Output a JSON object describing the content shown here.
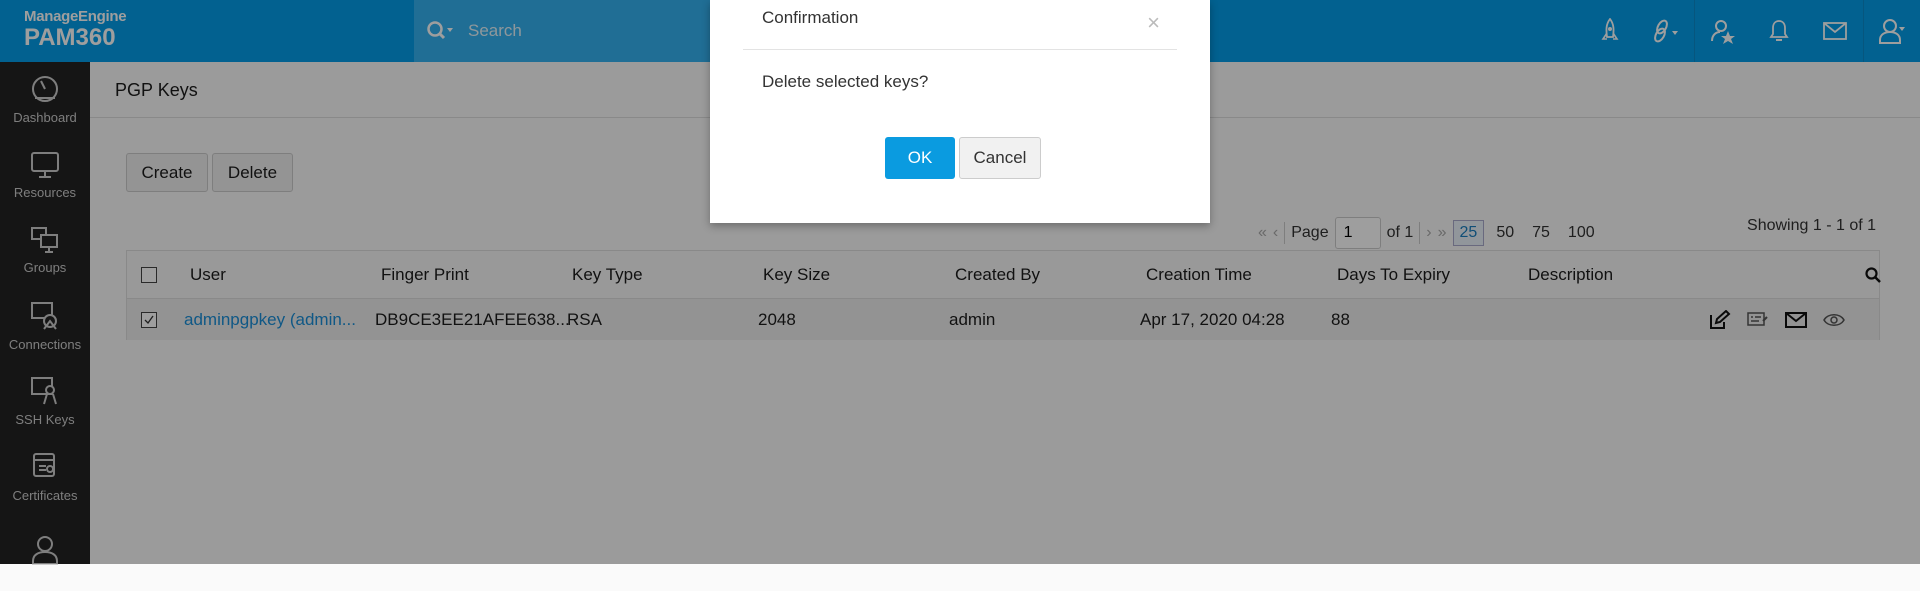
{
  "header": {
    "brand": "ManageEngine",
    "product": "PAM360",
    "search_placeholder": "Search"
  },
  "sidebar": {
    "items": [
      {
        "label": "Dashboard"
      },
      {
        "label": "Resources"
      },
      {
        "label": "Groups"
      },
      {
        "label": "Connections"
      },
      {
        "label": "SSH Keys"
      },
      {
        "label": "Certificates"
      }
    ]
  },
  "page": {
    "title": "PGP Keys",
    "create_label": "Create",
    "delete_label": "Delete"
  },
  "pager": {
    "page_label": "Page",
    "page_value": "1",
    "of_label": "of 1",
    "sizes": [
      "25",
      "50",
      "75",
      "100"
    ],
    "showing": "Showing 1 - 1 of 1"
  },
  "table": {
    "columns": [
      "User",
      "Finger Print",
      "Key Type",
      "Key Size",
      "Created By",
      "Creation Time",
      "Days To Expiry",
      "Description"
    ],
    "rows": [
      {
        "user": "adminpgpkey (admin...",
        "fingerprint": "DB9CE3EE21AFEE638...",
        "key_type": "RSA",
        "key_size": "2048",
        "created_by": "admin",
        "creation_time": "Apr 17, 2020 04:28",
        "days_to_expiry": "88",
        "description": ""
      }
    ]
  },
  "dialog": {
    "title": "Confirmation",
    "message": "Delete selected keys?",
    "ok_label": "OK",
    "cancel_label": "Cancel"
  }
}
